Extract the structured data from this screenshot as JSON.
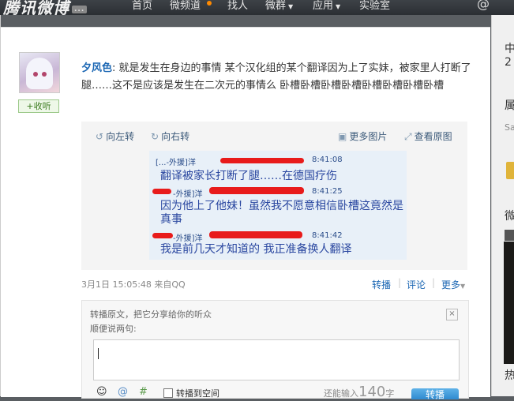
{
  "topbar": {
    "logo_text": "腾讯微博",
    "logo_badge": "...",
    "nav": [
      "首页",
      "微频道",
      "找人",
      "微群",
      "应用",
      "实验室"
    ],
    "at_icon": "@"
  },
  "post": {
    "author": "夕风色",
    "colon": ":",
    "text": "就是发生在身边的事情 某个汉化组的某个翻译因为上了实妹，被家里人打断了腿……这不是应该是发生在二次元的事情么 卧槽卧槽卧槽卧槽卧槽卧槽卧槽卧槽",
    "follow_label": "+收听",
    "rotate_left": "向左转",
    "rotate_right": "向右转",
    "more_images": "更多图片",
    "view_original": "查看原图",
    "timestamp": "3月1日 15:05:48 来自QQ",
    "actions": {
      "repost": "转播",
      "comment": "评论",
      "more": "更多"
    }
  },
  "chat_image": {
    "messages": [
      {
        "sender": "[...-外援]洋",
        "time": "8:41:08",
        "text": "翻译被家长打断了腿……在德国疗伤"
      },
      {
        "sender": "-外援]洋",
        "time": "8:41:25",
        "text": "因为他上了他妹！虽然我不愿意相信卧槽这竟然是真事"
      },
      {
        "sender": "-外援]洋",
        "time": "8:41:42",
        "text": "我是前几天才知道的  我正准备换人翻译"
      }
    ]
  },
  "repost_box": {
    "hint": "转播原文，把它分享给你的听众",
    "prompt": "顺便说两句:",
    "close": "×",
    "also_label": "转播到空间",
    "counter_prefix": "还能输入",
    "counter_num": "140",
    "counter_suffix": "字",
    "submit": "转播"
  },
  "right_column": {
    "r1": "中",
    "r1b": "2",
    "r2": "属",
    "r2b": "Sa",
    "r3": "微",
    "r4": "热"
  }
}
